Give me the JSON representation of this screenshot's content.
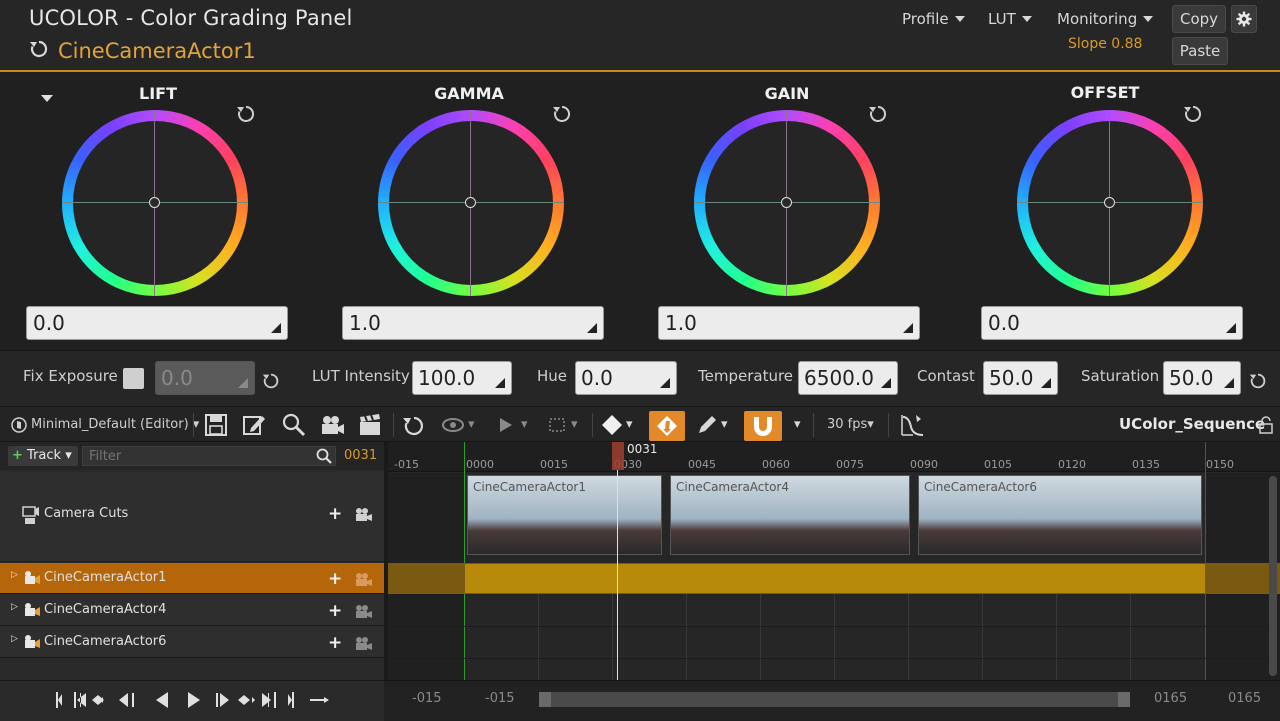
{
  "header": {
    "app_title": "UCOLOR - Color Grading Panel",
    "actor": "CineCameraActor1",
    "menus": [
      "Profile",
      "LUT",
      "Monitoring"
    ],
    "slope": "Slope 0.88",
    "copy_label": "Copy",
    "paste_label": "Paste"
  },
  "wheels": [
    {
      "title": "LIFT",
      "value": "0.0"
    },
    {
      "title": "GAMMA",
      "value": "1.0"
    },
    {
      "title": "GAIN",
      "value": "1.0"
    },
    {
      "title": "OFFSET",
      "value": "0.0"
    }
  ],
  "params": {
    "fix_exposure_label": "Fix Exposure",
    "fix_exposure_value": "0.0",
    "lut_intensity_label": "LUT Intensity",
    "lut_intensity_value": "100.0",
    "hue_label": "Hue",
    "hue_value": "0.0",
    "temperature_label": "Temperature",
    "temperature_value": "6500.0",
    "contrast_label": "Contast",
    "contrast_value": "50.0",
    "saturation_label": "Saturation",
    "saturation_value": "50.0"
  },
  "sequencer": {
    "preset": "Minimal_Default (Editor)",
    "fps": "30 fps",
    "sequence_name": "UColor_Sequence",
    "track_button": "Track",
    "filter_placeholder": "Filter",
    "current_frame": "0031",
    "playhead_label": "0031",
    "ruler": [
      "-015",
      "0000",
      "0015",
      "0030",
      "0045",
      "0060",
      "0075",
      "0090",
      "0105",
      "0120",
      "0135",
      "0150"
    ],
    "camera_cuts_label": "Camera Cuts",
    "tracks": [
      "CineCameraActor1",
      "CineCameraActor4",
      "CineCameraActor6"
    ],
    "clips": [
      "CineCameraActor1",
      "CineCameraActor4",
      "CineCameraActor6"
    ],
    "range_start": "-015",
    "view_start": "-015",
    "view_end": "0165",
    "range_end": "0165"
  },
  "colors": {
    "accent": "#c48a1c",
    "selected_track": "#b5660a",
    "track_bar": "#b88a0c"
  }
}
